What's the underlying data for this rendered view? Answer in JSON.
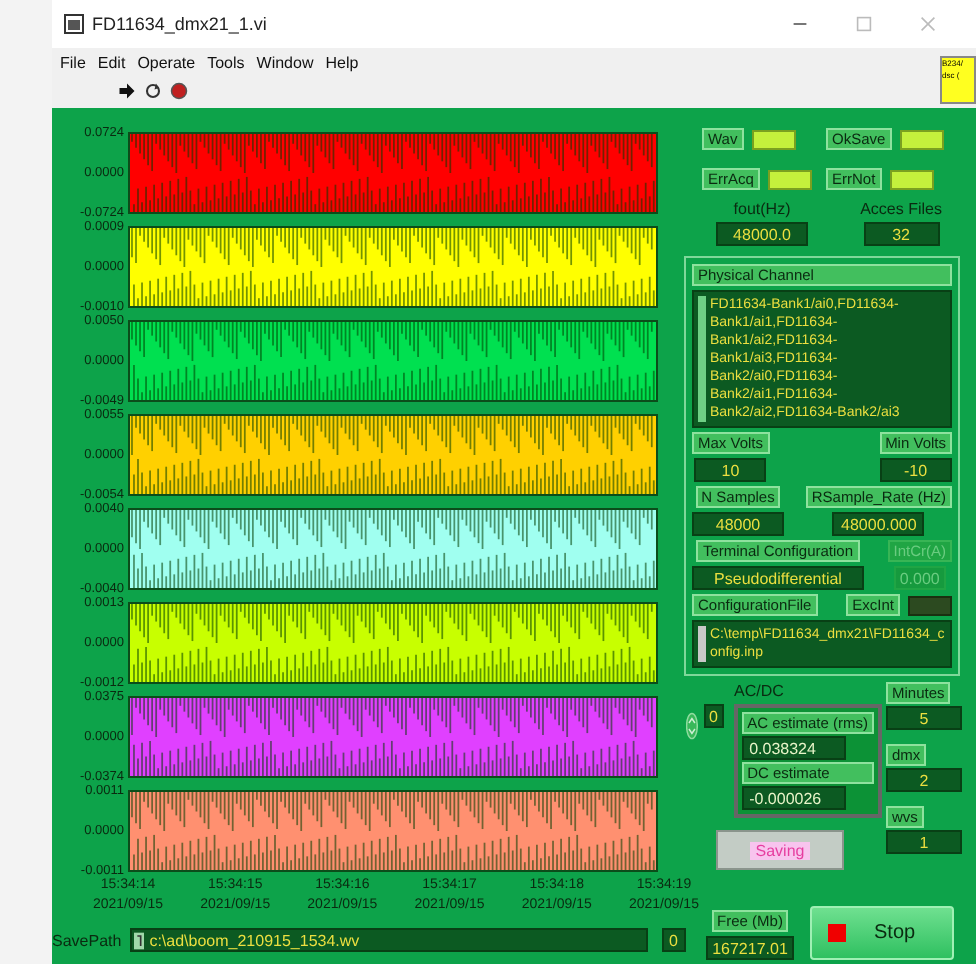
{
  "window": {
    "title": "FD11634_dmx21_1.vi"
  },
  "menu": [
    "File",
    "Edit",
    "Operate",
    "Tools",
    "Window",
    "Help"
  ],
  "side_note": [
    "B234/",
    "dsc ("
  ],
  "charts": [
    {
      "color": "#ff0000",
      "ticks": [
        "0.0724",
        "0.0000",
        "-0.0724"
      ]
    },
    {
      "color": "#ffff00",
      "ticks": [
        "0.0009",
        "0.0000",
        "-0.0010"
      ]
    },
    {
      "color": "#00e050",
      "ticks": [
        "0.0050",
        "0.0000",
        "-0.0049"
      ]
    },
    {
      "color": "#ffd000",
      "ticks": [
        "0.0055",
        "0.0000",
        "-0.0054"
      ]
    },
    {
      "color": "#a0fff0",
      "ticks": [
        "0.0040",
        "0.0000",
        "-0.0040"
      ]
    },
    {
      "color": "#c8ff00",
      "ticks": [
        "0.0013",
        "0.0000",
        "-0.0012"
      ]
    },
    {
      "color": "#e040ff",
      "ticks": [
        "0.0375",
        "0.0000",
        "-0.0374"
      ]
    },
    {
      "color": "#ff9070",
      "ticks": [
        "0.0011",
        "0.0000",
        "-0.0011"
      ]
    }
  ],
  "time_labels": [
    {
      "time": "15:34:14",
      "date": "2021/09/15"
    },
    {
      "time": "15:34:15",
      "date": "2021/09/15"
    },
    {
      "time": "15:34:16",
      "date": "2021/09/15"
    },
    {
      "time": "15:34:17",
      "date": "2021/09/15"
    },
    {
      "time": "15:34:18",
      "date": "2021/09/15"
    },
    {
      "time": "15:34:19",
      "date": "2021/09/15"
    }
  ],
  "save_path": {
    "label": "SavePath",
    "value": "c:\\ad\\boom_210915_1534.wv",
    "count": "0"
  },
  "leds": [
    {
      "label": "Wav",
      "on": true
    },
    {
      "label": "OkSave",
      "on": true
    },
    {
      "label": "ErrAcq",
      "on": true
    },
    {
      "label": "ErrNot",
      "on": true
    }
  ],
  "fout": {
    "label": "fout(Hz)",
    "value": "48000.0"
  },
  "acces_files": {
    "label": "Acces Files",
    "value": "32"
  },
  "physical_channel": {
    "label": "Physical Channel",
    "value": "FD11634-Bank1/ai0,FD11634-Bank1/ai1,FD11634-Bank1/ai2,FD11634-Bank1/ai3,FD11634-Bank2/ai0,FD11634-Bank2/ai1,FD11634-Bank2/ai2,FD11634-Bank2/ai3"
  },
  "max_volts": {
    "label": "Max Volts",
    "value": "10"
  },
  "min_volts": {
    "label": "Min Volts",
    "value": "-10"
  },
  "n_samples": {
    "label": "N Samples",
    "value": "48000"
  },
  "rsample_rate": {
    "label": "RSample_Rate (Hz)",
    "value": "48000.000"
  },
  "terminal_configuration": {
    "label": "Terminal Configuration",
    "value": "Pseudodifferential"
  },
  "intcr": {
    "label": "IntCr(A)",
    "value": "0.000",
    "disabled": true
  },
  "configuration_file": {
    "label": "ConfigurationFile",
    "value": "C:\\temp\\FD11634_dmx21\\FD11634_config.inp"
  },
  "excint": {
    "label": "ExcInt",
    "on": false
  },
  "acdc": {
    "label": "AC/DC",
    "index": "0",
    "ac_label": "AC estimate (rms)",
    "ac_value": "0.038324",
    "dc_label": "DC estimate",
    "dc_value": "-0.000026"
  },
  "minutes": {
    "label": "Minutes",
    "value": "5"
  },
  "dmx": {
    "label": "dmx",
    "value": "2"
  },
  "wvs": {
    "label": "wvs",
    "value": "1"
  },
  "saving": {
    "label": "Saving"
  },
  "free": {
    "label": "Free (Mb)",
    "value": "167217.01"
  },
  "stop": {
    "label": "Stop"
  }
}
